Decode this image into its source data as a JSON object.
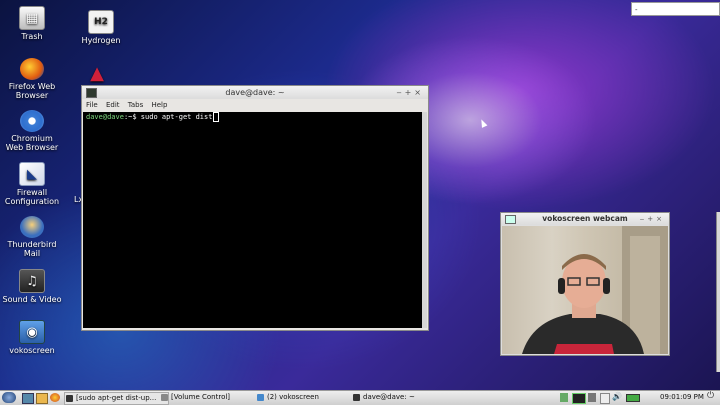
{
  "desktop": {
    "icons": [
      {
        "label_lines": [
          "Trash"
        ]
      },
      {
        "label_lines": [
          "Firefox Web",
          "Browser"
        ]
      },
      {
        "label_lines": [
          "Chromium",
          "Web Browser"
        ]
      },
      {
        "label_lines": [
          "Firewall",
          "Configuration"
        ]
      },
      {
        "label_lines": [
          "Thunderbird",
          "Mail"
        ]
      },
      {
        "label_lines": [
          "Sound & Video"
        ]
      },
      {
        "label_lines": [
          "vokoscreen"
        ]
      },
      {
        "label_lines": [
          "Hydrogen"
        ]
      },
      {
        "label_lines": [
          "H2"
        ]
      }
    ],
    "partial_label": "Lx",
    "top_right_field_value": "-"
  },
  "terminal": {
    "title": "dave@dave: ~",
    "menu": [
      "File",
      "Edit",
      "Tabs",
      "Help"
    ],
    "prompt_user": "dave@dave",
    "prompt_rest": ":~$ ",
    "command": "sudo apt-get dist"
  },
  "webcam": {
    "title": "vokoscreen webcam"
  },
  "taskbar": {
    "tasks": [
      {
        "label": "[sudo apt-get dist-up..."
      },
      {
        "label": "[Volume Control]"
      },
      {
        "label": "(2) vokoscreen"
      },
      {
        "label": "dave@dave: ~"
      }
    ],
    "clock": "09:01:09 PM"
  },
  "colors": {
    "terminal_bg": "#000000",
    "prompt_green": "#7fd87f",
    "taskbar_bg": "#dcdcdc"
  }
}
